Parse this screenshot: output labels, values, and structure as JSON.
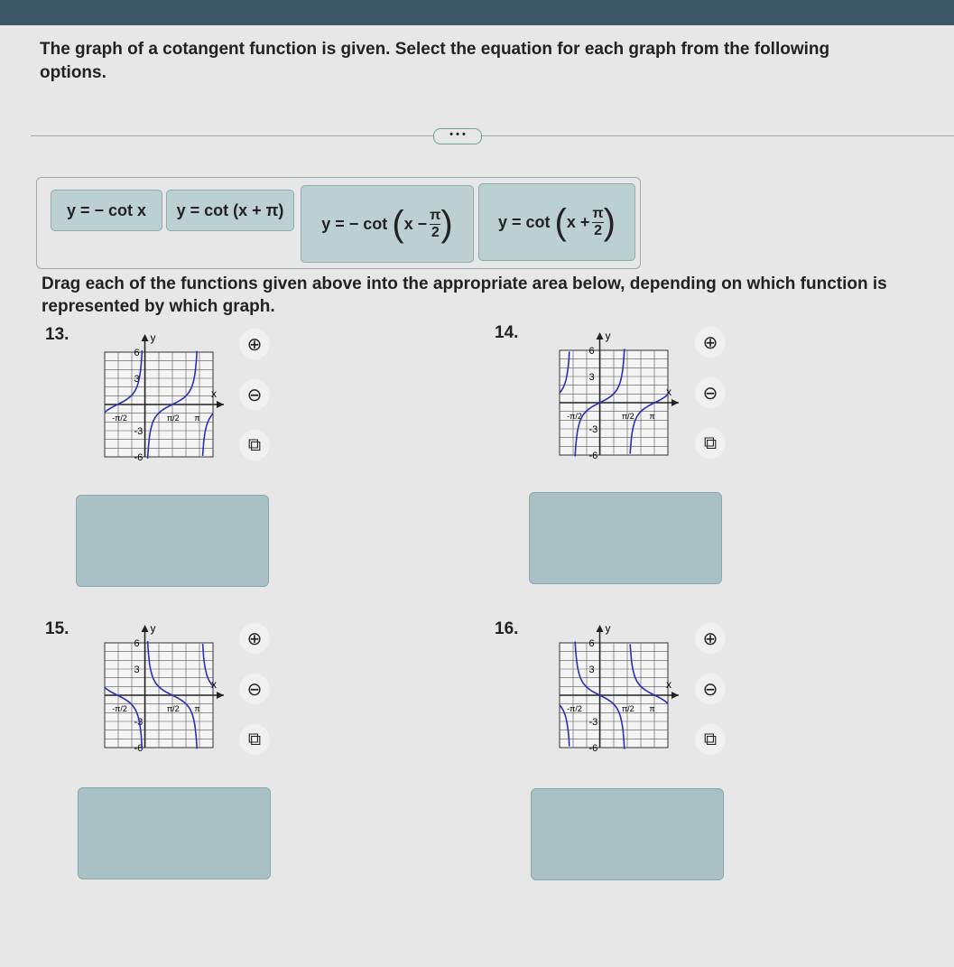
{
  "question": "The graph of a cotangent function is given. Select the equation for each graph from the following options.",
  "more_label": "• • •",
  "options": [
    {
      "prefix": "y = − cot x"
    },
    {
      "prefix": "y = cot (x + π)"
    },
    {
      "prefix": "y = − cot",
      "inner": "x −",
      "num": "π",
      "den": "2"
    },
    {
      "prefix": "y = cot",
      "inner": "x +",
      "num": "π",
      "den": "2"
    }
  ],
  "instruction": "Drag each of the functions given above into the appropriate area below, depending on which function is represented by which graph.",
  "graphs": [
    {
      "number": "13.",
      "y_label": "y",
      "x_label": "x",
      "y_ticks": [
        "6",
        "3",
        "-3",
        "-6"
      ],
      "x_ticks": [
        "-π/2",
        "π/2",
        "π"
      ]
    },
    {
      "number": "14.",
      "y_label": "y",
      "x_label": "x",
      "y_ticks": [
        "6",
        "3",
        "-3",
        "-6"
      ],
      "x_ticks": [
        "-π/2",
        "π/2",
        "π"
      ]
    },
    {
      "number": "15.",
      "y_label": "y",
      "x_label": "x",
      "y_ticks": [
        "6",
        "3",
        "-3",
        "-6"
      ],
      "x_ticks": [
        "-π/2",
        "π/2",
        "π"
      ]
    },
    {
      "number": "16.",
      "y_label": "y",
      "x_label": "x",
      "y_ticks": [
        "6",
        "3",
        "-3",
        "-6"
      ],
      "x_ticks": [
        "-π/2",
        "π/2",
        "π"
      ]
    }
  ],
  "tools": {
    "zoom_in": "magnify-plus-icon",
    "zoom_out": "magnify-minus-icon",
    "popout": "external-link-icon"
  },
  "colors": {
    "curve": "#2a2fb8",
    "dropzone": "#a9c1c5",
    "topbar": "#3d5866"
  }
}
